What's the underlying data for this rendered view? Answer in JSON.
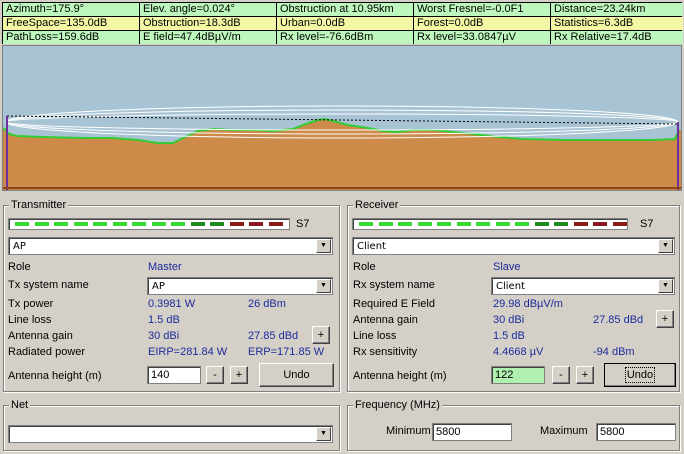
{
  "stats": [
    [
      {
        "text": "Azimuth=175.9°",
        "bg": "g"
      },
      {
        "text": "Elev. angle=0.024°",
        "bg": "g"
      },
      {
        "text": "Obstruction at 10.95km",
        "bg": "g"
      },
      {
        "text": "Worst Fresnel=-0.0F1",
        "bg": "g"
      },
      {
        "text": "Distance=23.24km",
        "bg": "g"
      }
    ],
    [
      {
        "text": "FreeSpace=135.0dB",
        "bg": "y"
      },
      {
        "text": "Obstruction=18.3dB",
        "bg": "y"
      },
      {
        "text": "Urban=0.0dB",
        "bg": "y"
      },
      {
        "text": "Forest=0.0dB",
        "bg": "y"
      },
      {
        "text": "Statistics=6.3dB",
        "bg": "y"
      }
    ],
    [
      {
        "text": "PathLoss=159.6dB",
        "bg": "g"
      },
      {
        "text": "E field=47.4dBµV/m",
        "bg": "g"
      },
      {
        "text": "Rx level=-76.6dBm",
        "bg": "g"
      },
      {
        "text": "Rx level=33.0847µV",
        "bg": "g"
      },
      {
        "text": "Rx Relative=17.4dB",
        "bg": "g"
      }
    ]
  ],
  "colors": {
    "sky": "#a8c3d3",
    "terrain": "#cd8a49",
    "terrain_edge": "#33cc33",
    "meter_green": "#33dd33",
    "meter_dark_green": "#1f8a1f",
    "meter_dark_red": "#8b1a1a"
  },
  "meter_colors": [
    "g",
    "g",
    "g",
    "g",
    "g",
    "g",
    "g",
    "g",
    "g",
    "dg",
    "dg",
    "r",
    "r",
    "r"
  ],
  "transmitter": {
    "title": "Transmitter",
    "signal": "S7",
    "unit_select": "AP",
    "role_label": "Role",
    "role_value": "Master",
    "system_label": "Tx system name",
    "system_value": "AP",
    "power_label": "Tx power",
    "power_w": "0.3981 W",
    "power_dbm": "26 dBm",
    "line_loss_label": "Line loss",
    "line_loss_value": "1.5 dB",
    "gain_label": "Antenna gain",
    "gain_dbi": "30 dBi",
    "gain_dbd": "27.85 dBd",
    "plus": "+",
    "radiated_label": "Radiated power",
    "eirp": "EIRP=281.84 W",
    "erp": "ERP=171.85 W",
    "height_label": "Antenna height (m)",
    "height_value": "140",
    "minus": "-",
    "undo": "Undo"
  },
  "receiver": {
    "title": "Receiver",
    "signal": "S7",
    "unit_select": "Client",
    "role_label": "Role",
    "role_value": "Slave",
    "system_label": "Rx system name",
    "system_value": "Client",
    "field_label": "Required E Field",
    "field_value": "29.98 dBµV/m",
    "gain_label": "Antenna gain",
    "gain_dbi": "30 dBi",
    "gain_dbd": "27.85 dBd",
    "plus": "+",
    "line_loss_label": "Line loss",
    "line_loss_value": "1.5 dB",
    "sens_label": "Rx sensitivity",
    "sens_uv": "4.4668 µV",
    "sens_dbm": "-94 dBm",
    "height_label": "Antenna height (m)",
    "height_value": "122",
    "minus": "-",
    "undo": "Undo"
  },
  "net": {
    "title": "Net",
    "select_value": ""
  },
  "frequency": {
    "title": "Frequency (MHz)",
    "min_label": "Minimum",
    "min_value": "5800",
    "max_label": "Maximum",
    "max_value": "5800"
  }
}
